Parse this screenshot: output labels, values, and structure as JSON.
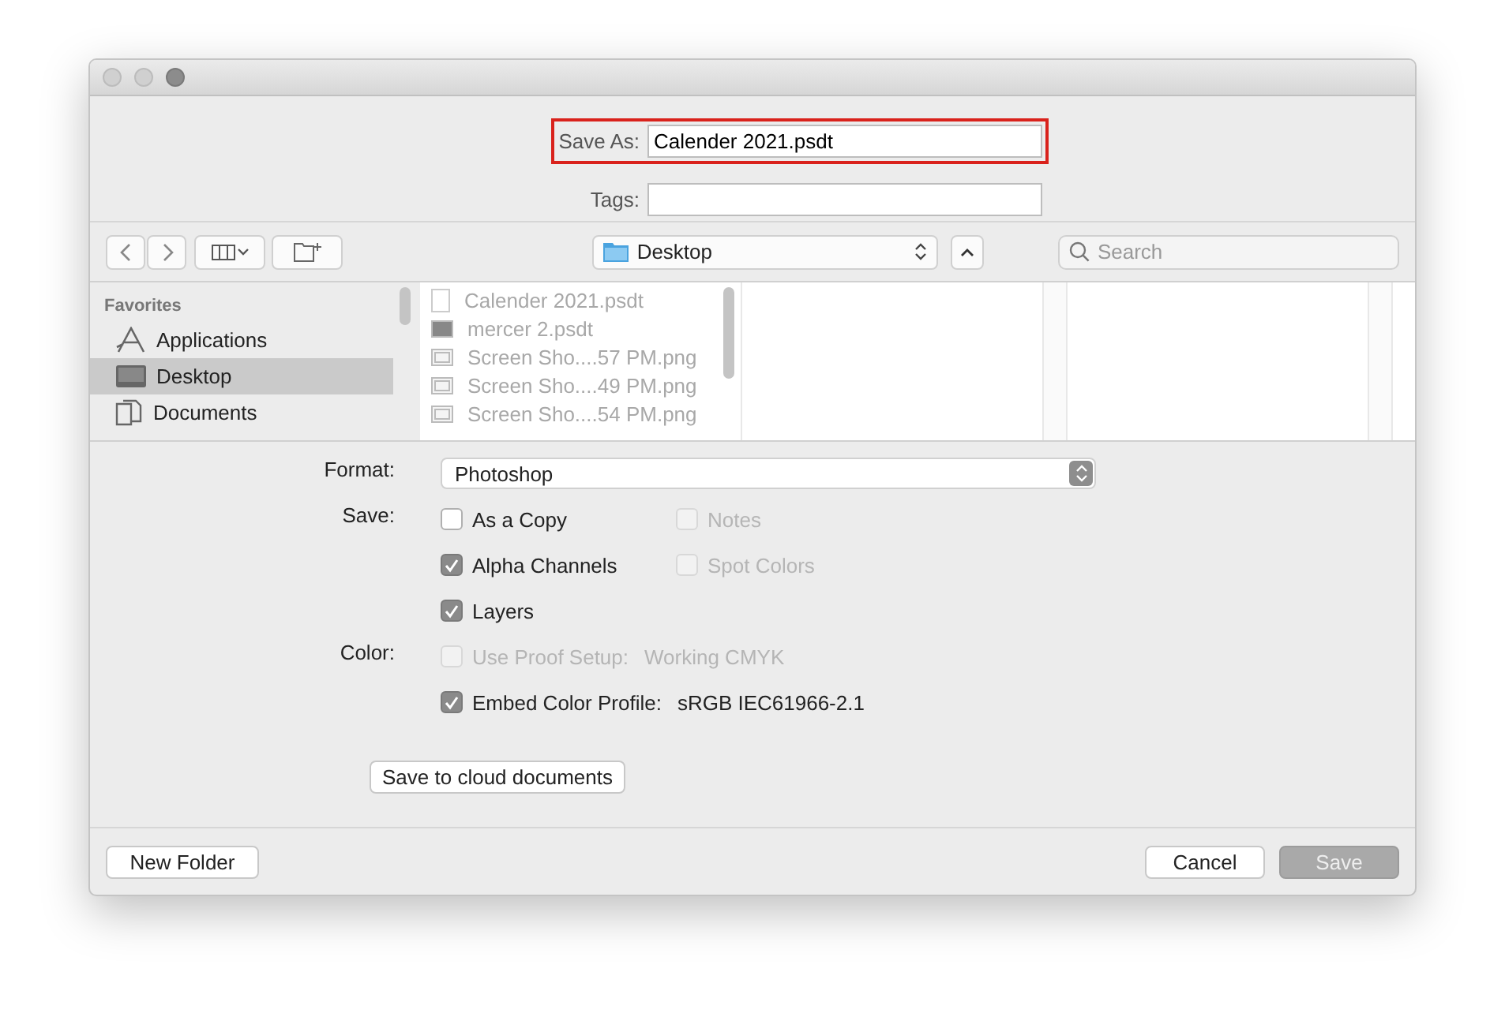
{
  "save_as": {
    "label": "Save As:",
    "value": "Calender 2021.psdt",
    "highlighted": true
  },
  "tags": {
    "label": "Tags:"
  },
  "location": {
    "value": "Desktop"
  },
  "search": {
    "placeholder": "Search"
  },
  "sidebar": {
    "heading": "Favorites",
    "items": [
      {
        "label": "Applications",
        "selected": false
      },
      {
        "label": "Desktop",
        "selected": true
      },
      {
        "label": "Documents",
        "selected": false
      }
    ]
  },
  "files": [
    {
      "name": "Calender 2021.psdt"
    },
    {
      "name": "mercer 2.psdt"
    },
    {
      "name": "Screen Sho....57 PM.png"
    },
    {
      "name": "Screen Sho....49 PM.png"
    },
    {
      "name": "Screen Sho....54 PM.png"
    }
  ],
  "format": {
    "label": "Format:",
    "value": "Photoshop"
  },
  "option_groups": [
    {
      "label": "Save:",
      "rows": [
        [
          {
            "label": "As a Copy",
            "checked": false,
            "disabled": false
          },
          {
            "label": "Notes",
            "checked": false,
            "disabled": true
          }
        ],
        [
          {
            "label": "Alpha Channels",
            "checked": true,
            "disabled": false
          },
          {
            "label": "Spot Colors",
            "checked": false,
            "disabled": true
          }
        ],
        [
          {
            "label": "Layers",
            "checked": true,
            "disabled": false
          }
        ]
      ]
    },
    {
      "label": "Color:",
      "rows": [
        [
          {
            "label": "Use Proof Setup:",
            "value": "Working CMYK",
            "checked": false,
            "disabled": true
          }
        ],
        [
          {
            "label": "Embed Color Profile:",
            "value": "sRGB IEC61966-2.1",
            "checked": true,
            "disabled": false
          }
        ]
      ]
    }
  ],
  "cloud_button": "Save to cloud documents",
  "buttons": [
    {
      "label": "New Folder",
      "disabled": false
    },
    {
      "label": "Cancel",
      "disabled": false
    },
    {
      "label": "Save",
      "disabled": true
    }
  ]
}
